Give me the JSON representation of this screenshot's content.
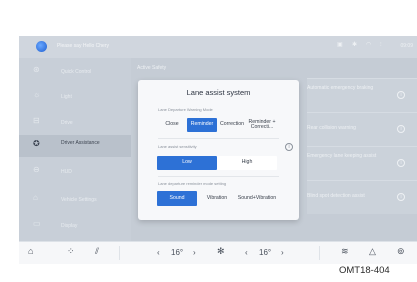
{
  "status_bar": {
    "voice_hint": "Please say Hello Chery",
    "icons": [
      "car-status-icon",
      "bluetooth-icon",
      "wifi-icon",
      "signal-icon"
    ],
    "time": "09:09"
  },
  "sidebar": {
    "items": [
      {
        "label": "Quick Control",
        "icon": "steering-icon"
      },
      {
        "label": "Light",
        "icon": "light-icon"
      },
      {
        "label": "Drive",
        "icon": "drive-icon"
      },
      {
        "label": "Driver Assistance",
        "icon": "driver-assistance-icon",
        "active": true
      },
      {
        "label": "HUD",
        "icon": "hud-icon"
      },
      {
        "label": "Vehicle Settings",
        "icon": "vehicle-icon"
      },
      {
        "label": "Display",
        "icon": "display-icon"
      }
    ]
  },
  "main": {
    "section_title": "Active Safety",
    "rows": [
      {
        "label": "Automatic emergency braking"
      },
      {
        "label": "Rear collision warning"
      },
      {
        "label": "Emergency lane keeping assist"
      },
      {
        "label": "Blind spot detection assist"
      }
    ]
  },
  "dialog": {
    "title": "Lane assist system",
    "mode_label": "Lane Departure Warning Mode",
    "mode_options": [
      "Close",
      "Reminder",
      "Correction",
      "Reminder + Correcti..."
    ],
    "mode_selected": "Reminder",
    "sensitivity_label": "Lane assist sensitivity",
    "sensitivity_options": [
      "Low",
      "High"
    ],
    "sensitivity_selected": "Low",
    "reminder_label": "Lane departure reminder mode setting",
    "reminder_options": [
      "Sound",
      "Vibration",
      "Sound+Vibration"
    ],
    "reminder_selected": "Sound"
  },
  "dock": {
    "left_temp": "16",
    "right_temp": "16",
    "temp_unit": "°"
  },
  "figure_code": "OMT18-404",
  "colors": {
    "accent": "#2d71d6",
    "screen_bg": "#c5ccd5",
    "dialog_bg": "#f7f8fa"
  }
}
